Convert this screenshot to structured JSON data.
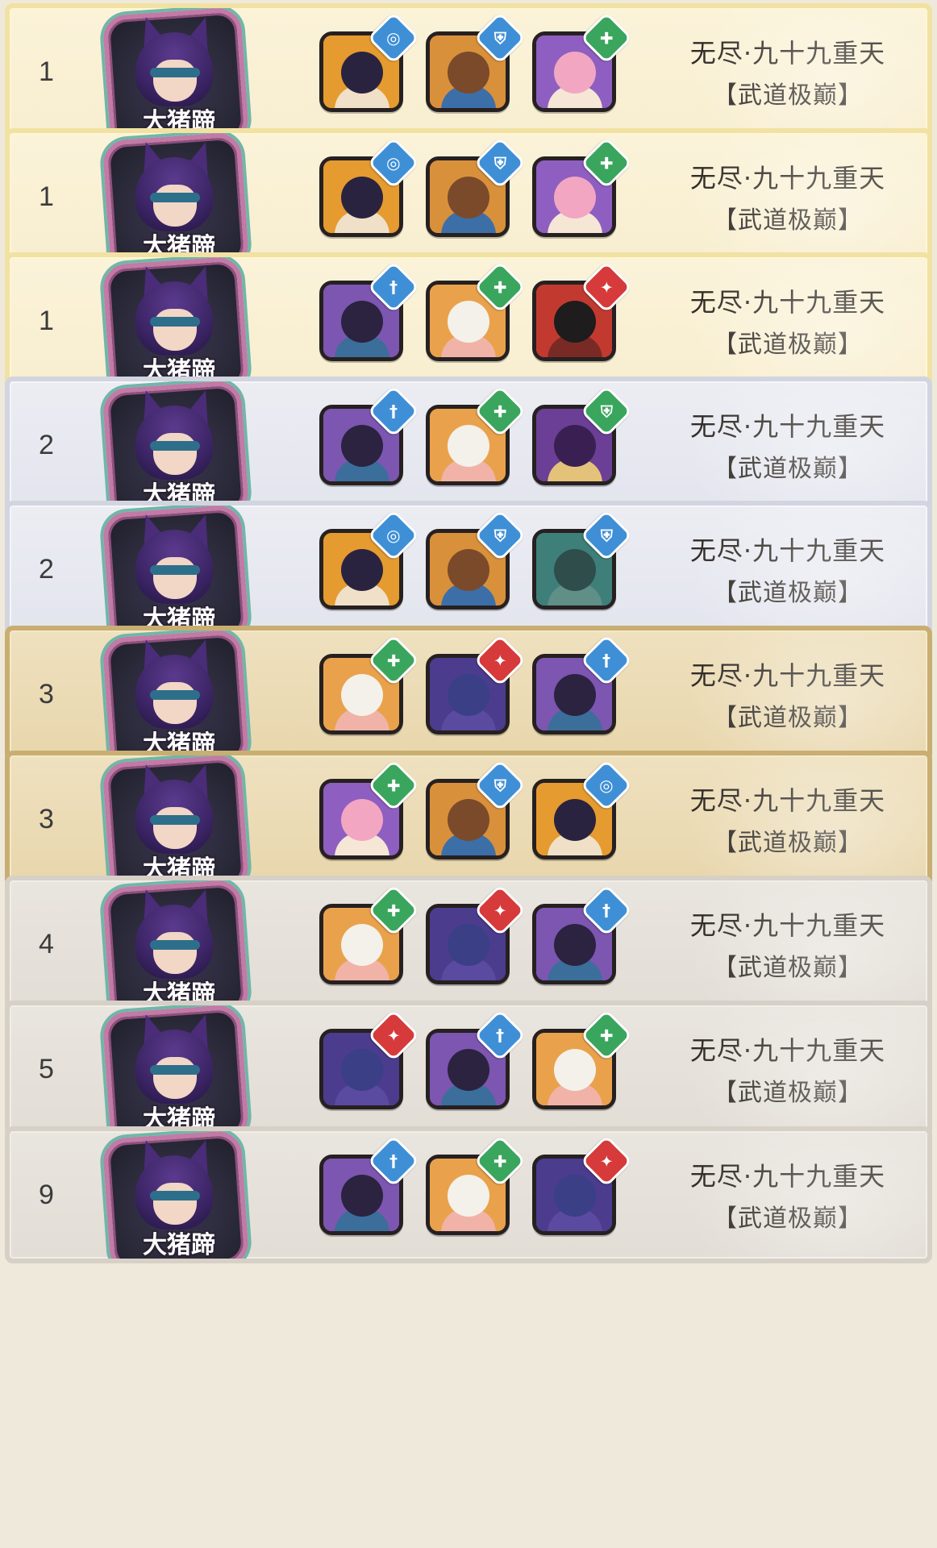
{
  "colors": {
    "badge": {
      "water": "#3f8fd6",
      "shield": "#3f8fd6",
      "heal": "#3aa55c",
      "sword": "#3f8fd6",
      "fire": "#d63a3a"
    },
    "tiers": {
      "gold": "#f8eed0",
      "silver": "#e3e5ee",
      "bronze": "#e8d6ac",
      "plain": "#e2ddd5"
    }
  },
  "rows": [
    {
      "rank": "1",
      "tier": "gold",
      "player": {
        "name": "大猪蹄"
      },
      "heroes": [
        {
          "portrait": "dark-haired-girl",
          "badge_icon": "water-icon",
          "badge_glyph": "◎",
          "badge_color": "#3f8fd6"
        },
        {
          "portrait": "toad-warrior",
          "badge_icon": "shield-icon",
          "badge_glyph": "⛨",
          "badge_color": "#3f8fd6"
        },
        {
          "portrait": "pink-haired-girl",
          "badge_icon": "heal-icon",
          "badge_glyph": "✚",
          "badge_color": "#3aa55c"
        }
      ],
      "stage": {
        "line1": "无尽·九十九重天",
        "line2": "【武道极巅】"
      }
    },
    {
      "rank": "1",
      "tier": "gold",
      "player": {
        "name": "大猪蹄"
      },
      "heroes": [
        {
          "portrait": "dark-haired-girl",
          "badge_icon": "water-icon",
          "badge_glyph": "◎",
          "badge_color": "#3f8fd6"
        },
        {
          "portrait": "toad-warrior",
          "badge_icon": "shield-icon",
          "badge_glyph": "⛨",
          "badge_color": "#3f8fd6"
        },
        {
          "portrait": "pink-haired-girl",
          "badge_icon": "heal-icon",
          "badge_glyph": "✚",
          "badge_color": "#3aa55c"
        }
      ],
      "stage": {
        "line1": "无尽·九十九重天",
        "line2": "【武道极巅】"
      }
    },
    {
      "rank": "1",
      "tier": "gold",
      "player": {
        "name": "大猪蹄"
      },
      "heroes": [
        {
          "portrait": "masked-blue-girl",
          "badge_icon": "sword-icon",
          "badge_glyph": "†",
          "badge_color": "#3f8fd6"
        },
        {
          "portrait": "white-haired-girl",
          "badge_icon": "heal-icon",
          "badge_glyph": "✚",
          "badge_color": "#3aa55c"
        },
        {
          "portrait": "black-haired-boy",
          "badge_icon": "fire-icon",
          "badge_glyph": "✦",
          "badge_color": "#d63a3a"
        }
      ],
      "stage": {
        "line1": "无尽·九十九重天",
        "line2": "【武道极巅】"
      }
    },
    {
      "rank": "2",
      "tier": "silver",
      "player": {
        "name": "大猪蹄"
      },
      "heroes": [
        {
          "portrait": "masked-blue-girl",
          "badge_icon": "sword-icon",
          "badge_glyph": "†",
          "badge_color": "#3f8fd6"
        },
        {
          "portrait": "white-haired-girl",
          "badge_icon": "heal-icon",
          "badge_glyph": "✚",
          "badge_color": "#3aa55c"
        },
        {
          "portrait": "purple-queen",
          "badge_icon": "shield-icon",
          "badge_glyph": "⛨",
          "badge_color": "#3aa55c"
        }
      ],
      "stage": {
        "line1": "无尽·九十九重天",
        "line2": "【武道极巅】"
      }
    },
    {
      "rank": "2",
      "tier": "silver",
      "player": {
        "name": "大猪蹄"
      },
      "heroes": [
        {
          "portrait": "dark-haired-girl",
          "badge_icon": "water-icon",
          "badge_glyph": "◎",
          "badge_color": "#3f8fd6"
        },
        {
          "portrait": "toad-warrior",
          "badge_icon": "shield-icon",
          "badge_glyph": "⛨",
          "badge_color": "#3f8fd6"
        },
        {
          "portrait": "teal-armored-man",
          "badge_icon": "shield-icon",
          "badge_glyph": "⛨",
          "badge_color": "#3f8fd6"
        }
      ],
      "stage": {
        "line1": "无尽·九十九重天",
        "line2": "【武道极巅】"
      }
    },
    {
      "rank": "3",
      "tier": "bronze",
      "player": {
        "name": "大猪蹄"
      },
      "heroes": [
        {
          "portrait": "white-haired-girl",
          "badge_icon": "heal-icon",
          "badge_glyph": "✚",
          "badge_color": "#3aa55c"
        },
        {
          "portrait": "harp-mage",
          "badge_icon": "fire-icon",
          "badge_glyph": "✦",
          "badge_color": "#d63a3a"
        },
        {
          "portrait": "masked-blue-girl",
          "badge_icon": "sword-icon",
          "badge_glyph": "†",
          "badge_color": "#3f8fd6"
        }
      ],
      "stage": {
        "line1": "无尽·九十九重天",
        "line2": "【武道极巅】"
      }
    },
    {
      "rank": "3",
      "tier": "bronze",
      "player": {
        "name": "大猪蹄"
      },
      "heroes": [
        {
          "portrait": "pink-haired-girl",
          "badge_icon": "heal-icon",
          "badge_glyph": "✚",
          "badge_color": "#3aa55c"
        },
        {
          "portrait": "toad-warrior",
          "badge_icon": "shield-icon",
          "badge_glyph": "⛨",
          "badge_color": "#3f8fd6"
        },
        {
          "portrait": "dark-haired-girl",
          "badge_icon": "water-icon",
          "badge_glyph": "◎",
          "badge_color": "#3f8fd6"
        }
      ],
      "stage": {
        "line1": "无尽·九十九重天",
        "line2": "【武道极巅】"
      }
    },
    {
      "rank": "4",
      "tier": "plain",
      "player": {
        "name": "大猪蹄"
      },
      "heroes": [
        {
          "portrait": "white-haired-girl",
          "badge_icon": "heal-icon",
          "badge_glyph": "✚",
          "badge_color": "#3aa55c"
        },
        {
          "portrait": "harp-mage",
          "badge_icon": "fire-icon",
          "badge_glyph": "✦",
          "badge_color": "#d63a3a"
        },
        {
          "portrait": "masked-blue-girl",
          "badge_icon": "sword-icon",
          "badge_glyph": "†",
          "badge_color": "#3f8fd6"
        }
      ],
      "stage": {
        "line1": "无尽·九十九重天",
        "line2": "【武道极巅】"
      }
    },
    {
      "rank": "5",
      "tier": "plain",
      "player": {
        "name": "大猪蹄"
      },
      "heroes": [
        {
          "portrait": "harp-mage",
          "badge_icon": "fire-icon",
          "badge_glyph": "✦",
          "badge_color": "#d63a3a"
        },
        {
          "portrait": "masked-blue-girl",
          "badge_icon": "sword-icon",
          "badge_glyph": "†",
          "badge_color": "#3f8fd6"
        },
        {
          "portrait": "white-haired-girl",
          "badge_icon": "heal-icon",
          "badge_glyph": "✚",
          "badge_color": "#3aa55c"
        }
      ],
      "stage": {
        "line1": "无尽·九十九重天",
        "line2": "【武道极巅】"
      }
    },
    {
      "rank": "9",
      "tier": "plain",
      "player": {
        "name": "大猪蹄"
      },
      "heroes": [
        {
          "portrait": "masked-blue-girl",
          "badge_icon": "sword-icon",
          "badge_glyph": "†",
          "badge_color": "#3f8fd6"
        },
        {
          "portrait": "white-haired-girl",
          "badge_icon": "heal-icon",
          "badge_glyph": "✚",
          "badge_color": "#3aa55c"
        },
        {
          "portrait": "harp-mage",
          "badge_icon": "fire-icon",
          "badge_glyph": "✦",
          "badge_color": "#d63a3a"
        }
      ],
      "stage": {
        "line1": "无尽·九十九重天",
        "line2": "【武道极巅】"
      }
    }
  ]
}
